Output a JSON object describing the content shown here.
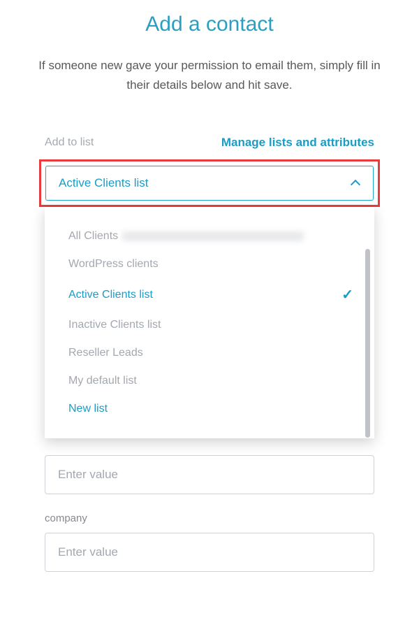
{
  "header": {
    "title": "Add a contact",
    "description": "If someone new gave your permission to email them, simply fill in their details below and hit save."
  },
  "list_section": {
    "label": "Add to list",
    "manage_link": "Manage lists and attributes",
    "selected": "Active Clients list",
    "options": [
      {
        "label": "All Clients",
        "selected": false
      },
      {
        "label": "WordPress clients",
        "selected": false
      },
      {
        "label": "Active Clients list",
        "selected": true
      },
      {
        "label": "Inactive Clients list",
        "selected": false
      },
      {
        "label": "Reseller Leads",
        "selected": false
      },
      {
        "label": "My default list",
        "selected": false
      }
    ],
    "new_list_label": "New list"
  },
  "fields": {
    "generic_placeholder": "Enter value",
    "company_label": "company",
    "company_placeholder": "Enter value"
  }
}
